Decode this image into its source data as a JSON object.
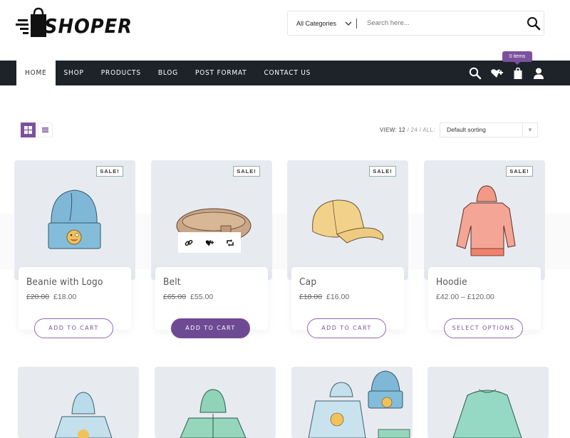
{
  "brand": {
    "name": "SHOPER"
  },
  "search": {
    "category": "All Categories",
    "placeholder": "Search here..."
  },
  "nav": {
    "items": [
      {
        "label": "HOME",
        "active": true
      },
      {
        "label": "SHOP",
        "active": false
      },
      {
        "label": "PRODUCTS",
        "active": false
      },
      {
        "label": "BLOG",
        "active": false
      },
      {
        "label": "POST FORMAT",
        "active": false
      },
      {
        "label": "CONTACT US",
        "active": false
      }
    ],
    "icons": [
      "search-icon",
      "wishlist-icon",
      "cart-icon",
      "user-icon"
    ],
    "cart_badge": "0 items"
  },
  "toolbar": {
    "view_prefix": "VIEW:",
    "view_options": [
      "12",
      "24",
      "ALL:"
    ],
    "view_current": "12",
    "sort_selected": "Default sorting",
    "layout_modes": [
      "grid-view-icon",
      "list-view-icon"
    ],
    "layout_active": "grid"
  },
  "colors": {
    "accent": "#7b519d",
    "nav_bg": "#1e232a",
    "card_bg": "#e7ebf0"
  },
  "products": [
    {
      "title": "Beanie with Logo",
      "old_price": "£20.00",
      "price": "£18.00",
      "sale": "SALE!",
      "button": "ADD TO CART",
      "image": "beanie"
    },
    {
      "title": "Belt",
      "old_price": "£65.00",
      "price": "£55.00",
      "sale": "SALE!",
      "button": "ADD TO CART",
      "image": "belt",
      "hovered": true,
      "hover_actions": [
        "link-icon",
        "wishlist-add-icon",
        "compare-icon"
      ]
    },
    {
      "title": "Cap",
      "old_price": "£18.00",
      "price": "£16.00",
      "sale": "SALE!",
      "button": "ADD TO CART",
      "image": "cap"
    },
    {
      "title": "Hoodie",
      "old_price": "",
      "price": "£42.00 – £120.00",
      "sale": "SALE!",
      "button": "SELECT OPTIONS",
      "image": "hoodie"
    }
  ],
  "products_row2": [
    {
      "image": "hoodie-with-logo"
    },
    {
      "image": "hoodie-with-zipper"
    },
    {
      "image": "logo-collection"
    },
    {
      "image": "long-sleeve-tee"
    }
  ]
}
